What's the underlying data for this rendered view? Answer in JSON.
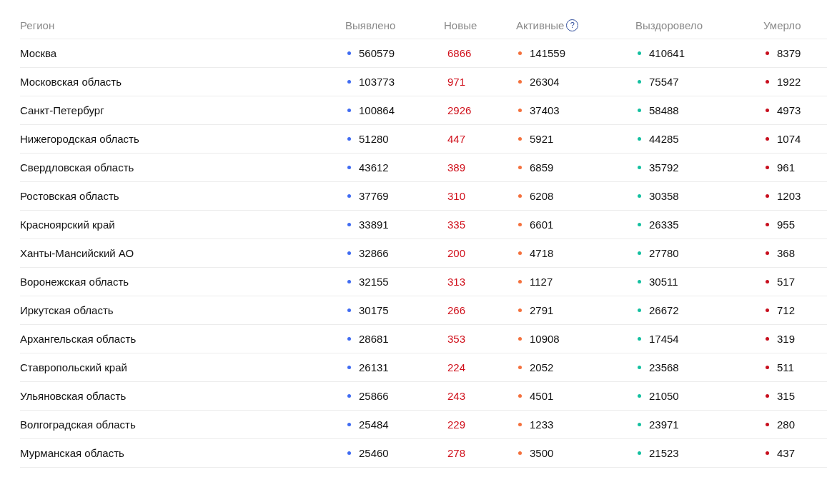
{
  "table": {
    "columns": [
      {
        "label": "Регион",
        "kind": "text"
      },
      {
        "label": "Выявлено",
        "kind": "dot",
        "color": "#3f6bf2"
      },
      {
        "label": "Новые",
        "kind": "accent",
        "color": "#d0101b"
      },
      {
        "label": "Активные",
        "kind": "dot",
        "color": "#f4703c",
        "help": "?"
      },
      {
        "label": "Выздоровело",
        "kind": "dot",
        "color": "#14c0a0"
      },
      {
        "label": "Умерло",
        "kind": "dot",
        "color": "#c80f1e"
      }
    ],
    "rows": [
      [
        "Москва",
        "560579",
        "6866",
        "141559",
        "410641",
        "8379"
      ],
      [
        "Московская область",
        "103773",
        "971",
        "26304",
        "75547",
        "1922"
      ],
      [
        "Санкт-Петербург",
        "100864",
        "2926",
        "37403",
        "58488",
        "4973"
      ],
      [
        "Нижегородская область",
        "51280",
        "447",
        "5921",
        "44285",
        "1074"
      ],
      [
        "Свердловская область",
        "43612",
        "389",
        "6859",
        "35792",
        "961"
      ],
      [
        "Ростовская область",
        "37769",
        "310",
        "6208",
        "30358",
        "1203"
      ],
      [
        "Красноярский край",
        "33891",
        "335",
        "6601",
        "26335",
        "955"
      ],
      [
        "Ханты-Мансийский АО",
        "32866",
        "200",
        "4718",
        "27780",
        "368"
      ],
      [
        "Воронежская область",
        "32155",
        "313",
        "1127",
        "30511",
        "517"
      ],
      [
        "Иркутская область",
        "30175",
        "266",
        "2791",
        "26672",
        "712"
      ],
      [
        "Архангельская область",
        "28681",
        "353",
        "10908",
        "17454",
        "319"
      ],
      [
        "Ставропольский край",
        "26131",
        "224",
        "2052",
        "23568",
        "511"
      ],
      [
        "Ульяновская область",
        "25866",
        "243",
        "4501",
        "21050",
        "315"
      ],
      [
        "Волгоградская область",
        "25484",
        "229",
        "1233",
        "23971",
        "280"
      ],
      [
        "Мурманская область",
        "25460",
        "278",
        "3500",
        "21523",
        "437"
      ]
    ]
  }
}
